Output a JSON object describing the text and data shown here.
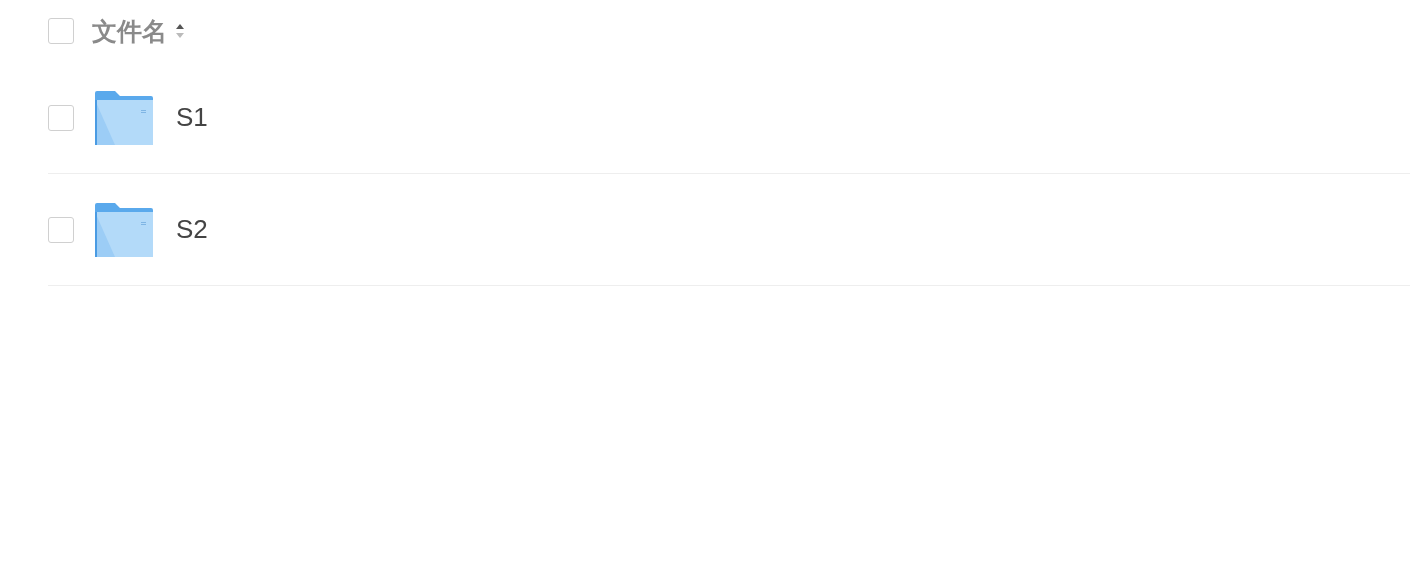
{
  "header": {
    "checked": false,
    "label": "文件名",
    "sort_ascending": true
  },
  "rows": [
    {
      "name": "S1",
      "checked": false
    },
    {
      "name": "S2",
      "checked": false
    }
  ]
}
